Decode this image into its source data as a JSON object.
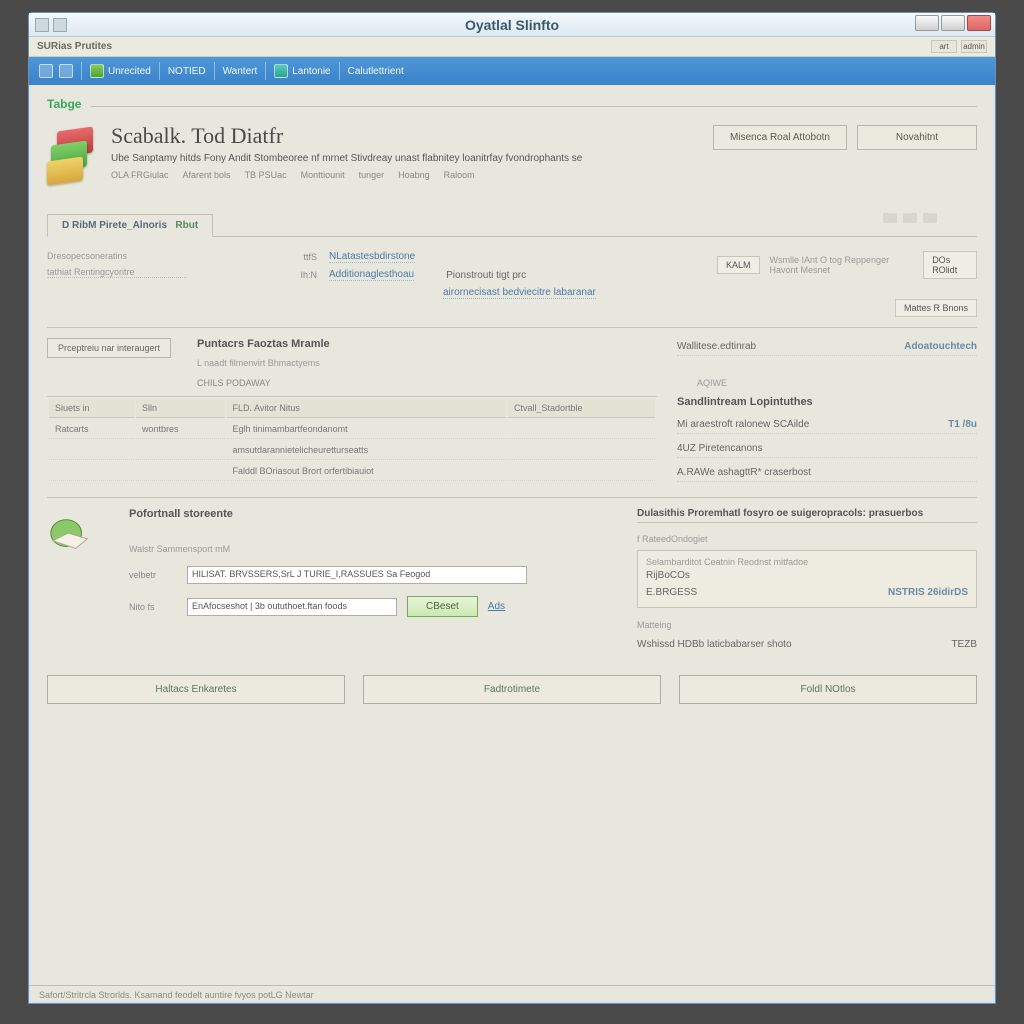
{
  "window": {
    "title": "Oyatlal Slinfto"
  },
  "appbar": {
    "left": "SURias Prutites",
    "tags": [
      "art",
      "admin"
    ]
  },
  "toolbar": {
    "items": [
      {
        "label": ""
      },
      {
        "label": ""
      },
      {
        "label": "Unrecited",
        "icon": "green"
      },
      {
        "label": "NOTIED"
      },
      {
        "label": "Wantert"
      },
      {
        "label": "Lantonie",
        "icon": "teal"
      },
      {
        "label": "Calutlettrient"
      }
    ]
  },
  "brand": "Tabge",
  "page": {
    "title": "Scabalk. Tod Diatfr",
    "subtitle": "Ube Sanptamy hitds Fony Andit Stombeoree nf mrnet Stivdreay unast flabnitey loanitrfay fvondrophants se",
    "meta": [
      "OLA FRGiulac",
      "Afarent bols",
      "TB  PSUac",
      "Monttiounit",
      "tunger",
      "Hoabng",
      "Raloom"
    ]
  },
  "actions": {
    "primary": "Misenca Roal Attobotn",
    "secondary": "Novahitnt"
  },
  "tabs": [
    "D RibM  Pirete_Alnoris",
    "Rbut"
  ],
  "fields": {
    "left_note": "Dresopecsoneratins",
    "left_note2": "tathiat Rentingcyoritre",
    "r1_lbl": "ttfS",
    "r1_val": "NLatastesbdirstone",
    "r2_lbl": "Ih:N",
    "r2_val": "Additionaglesthoau",
    "r2_sub": "Pionstrouti tigt prc",
    "r2_link": "airornecisast bedviecitre labaranar",
    "badge": "KALM",
    "mid_meta": "Wsmlle IAnt  O tog   Reppenger Havont Mesnet",
    "right_badge": "DOs ROlidt",
    "r3_btn": "Mattes R Bnons"
  },
  "section2": {
    "btn": "Prceptreiu nar interaugert",
    "title": "Puntacrs Faoztas Mramle",
    "sub": "L naadt filmenvirt Bhmactyems",
    "line": "CHILS PODAWAY",
    "right_a": "Wallitese.edtinrab",
    "right_a_v": "Adoatouchtech",
    "right_b": "AQIWE"
  },
  "tbl": {
    "cols": [
      "Siuets in",
      "Slln",
      "FLD. Avitor Nitus",
      "Ctvall_Stadortble"
    ],
    "rows": [
      [
        "Ratcarts",
        "wontbres",
        "Eglh tinimambartfeondanomt",
        ""
      ],
      [
        "",
        "",
        "amsutdarannietelicheuretturseatts",
        ""
      ],
      [
        "",
        "",
        "Falddl BOriasout Brort orfertibiauiot",
        ""
      ]
    ]
  },
  "right_summary": {
    "title": "Sandlintream Lopintuthes",
    "rows": [
      {
        "k": "Mi araestroft ralonew SCAilde",
        "v": "T1 /8u"
      },
      {
        "k": "4UZ Piretencanons",
        "v": ""
      },
      {
        "k": "A.RAWe ashagttR* craserbost",
        "v": ""
      }
    ]
  },
  "lower_left": {
    "title": "Pofortnall storeente",
    "line1": "Walstr  Sammensport mM",
    "lbl_a": "velbetr",
    "val_a": "HILISAT. BRVSSERS,SrL    J TURIE_I,RASSUES  Sa   Feogod",
    "lbl_b": "Nito fs",
    "val_b": "EnAfocseshot | 3b oututhoet.ftan foods",
    "btn": "CBeset",
    "link": "Ads"
  },
  "lower_right": {
    "title": "Dulasithis Proremhatl fosyro oe suigeropracols: prasuerbos",
    "sub": "f RateedOndogiet",
    "box_label": "Selambarditot Ceatnin Reodnst mitfadoe",
    "box_a": "RijBoCOs",
    "box_a_v": "",
    "box_b": "E.BRGESS",
    "box_b_v": "NSTRIS 26idirDS",
    "link_lbl": "Matteing",
    "link": "Wshissd HDBb laticbabarser shoto",
    "ico_v": "TEZB"
  },
  "footer": {
    "btns": [
      "Haltacs Enkaretes",
      "Fadtrotimete",
      "Foldl NOtlos"
    ]
  },
  "status": "Safort/Stritrcla Strorlds. Ksamand feodelt auntire fvyos potLG Newtar"
}
